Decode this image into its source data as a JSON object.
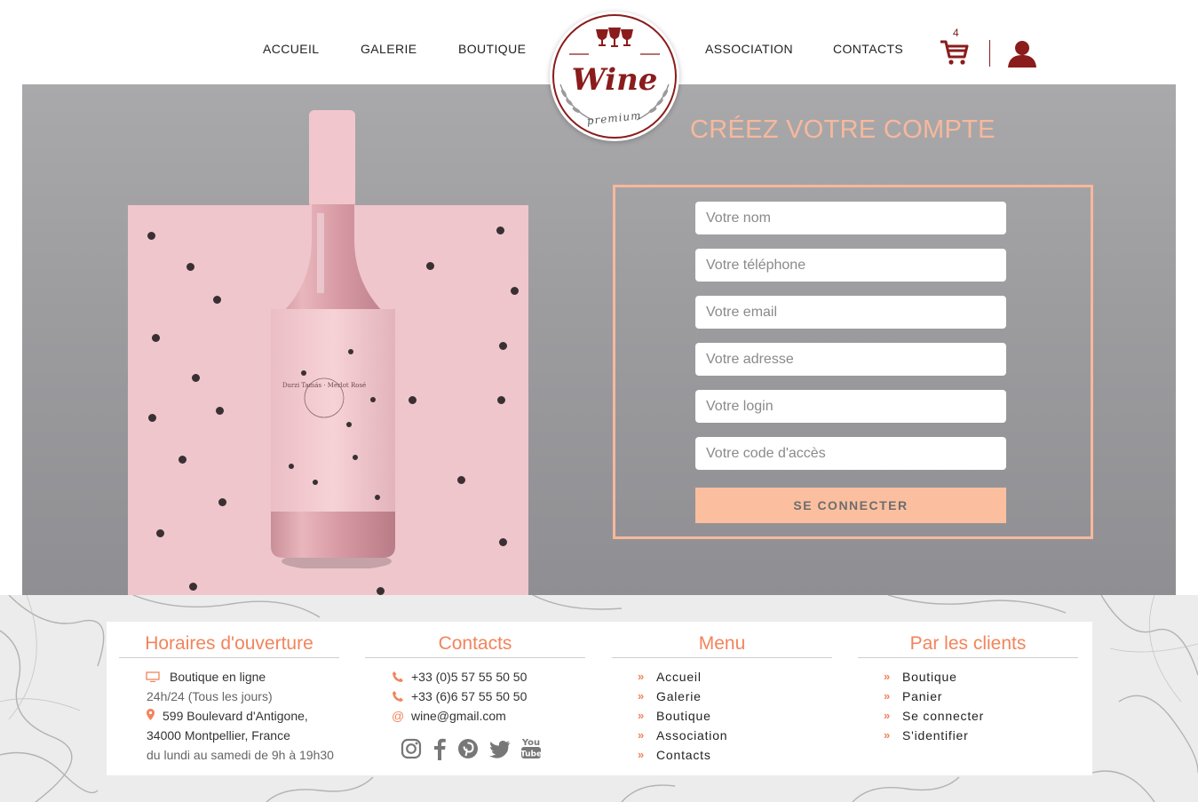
{
  "nav": {
    "items": [
      "ACCUEIL",
      "GALERIE",
      "BOUTIQUE",
      "ASSOCIATION",
      "CONTACTS"
    ],
    "cart_count": "4"
  },
  "logo": {
    "word": "Wine",
    "sub": "premium"
  },
  "hero": {
    "title": "CRÉEZ VOTRE COMPTE",
    "bottle_label": "Durzi Tamás · Merlot Rosé"
  },
  "form": {
    "fields": [
      {
        "placeholder": "Votre nom",
        "value": ""
      },
      {
        "placeholder": "Votre téléphone",
        "value": ""
      },
      {
        "placeholder": "Votre email",
        "value": ""
      },
      {
        "placeholder": "Votre adresse",
        "value": ""
      },
      {
        "placeholder": "Votre login",
        "value": ""
      },
      {
        "placeholder": "Votre code d'accès",
        "value": ""
      }
    ],
    "submit_label": "SE CONNECTER"
  },
  "footer": {
    "hours": {
      "title": "Horaires d'ouverture",
      "online": "Boutique en ligne",
      "online_hours": "24h/24 (Tous les jours)",
      "address1": "599 Boulevard d'Antigone,",
      "address2": "34000 Montpellier, France",
      "days": "du lundi au samedi de 9h à 19h30"
    },
    "contacts": {
      "title": "Contacts",
      "phone1": "+33 (0)5 57 55 50 50",
      "phone2": "+33 (6)6 57 55 50 50",
      "email": "wine@gmail.com",
      "social": [
        "instagram",
        "facebook",
        "pinterest",
        "twitter",
        "youtube"
      ]
    },
    "menu": {
      "title": "Menu",
      "items": [
        "Accueil",
        "Galerie",
        "Boutique",
        "Association",
        "Contacts"
      ]
    },
    "clients": {
      "title": "Par les clients",
      "items": [
        "Boutique",
        "Panier",
        "Se connecter",
        "S'identifier"
      ]
    }
  },
  "colors": {
    "brand": "#8a1c1c",
    "accent": "#f7b89c",
    "footer_accent": "#f2845c",
    "button": "#fbbf9f"
  }
}
